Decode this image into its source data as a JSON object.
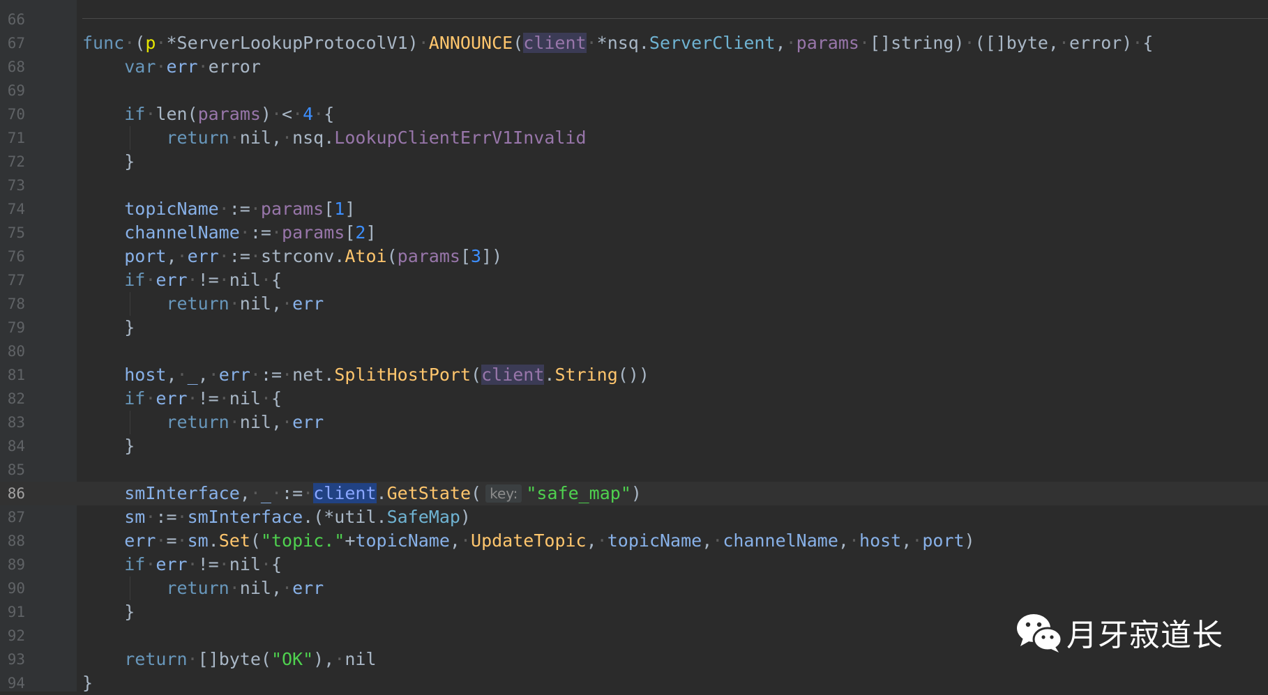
{
  "editor": {
    "current_line": "86",
    "lines": [
      {
        "n": "66"
      },
      {
        "n": "67",
        "tokens": [
          [
            "kw",
            "func"
          ],
          [
            "ws",
            "·"
          ],
          [
            "pt",
            "("
          ],
          [
            "rcv",
            "p"
          ],
          [
            "ws",
            "·"
          ],
          [
            "pt",
            "*ServerLookupProtocolV1"
          ],
          [
            "pt",
            ")"
          ],
          [
            "ws",
            "·"
          ],
          [
            "fn",
            "ANNOUNCE"
          ],
          [
            "pt",
            "("
          ],
          [
            "hl pr",
            "client"
          ],
          [
            "ws",
            "·"
          ],
          [
            "pt",
            "*nsq."
          ],
          [
            "tp",
            "ServerClient"
          ],
          [
            "pt",
            ","
          ],
          [
            "ws",
            "·"
          ],
          [
            "pr",
            "params"
          ],
          [
            "ws",
            "·"
          ],
          [
            "pt",
            "[]string)"
          ],
          [
            "ws",
            "·"
          ],
          [
            "pt",
            "([]byte,"
          ],
          [
            "ws",
            "·"
          ],
          [
            "pt",
            "error)"
          ],
          [
            "ws",
            "·"
          ],
          [
            "pt",
            "{"
          ]
        ]
      },
      {
        "n": "68",
        "tokens": [
          [
            "pt",
            "    "
          ],
          [
            "kw",
            "var"
          ],
          [
            "ws",
            "·"
          ],
          [
            "vr",
            "err"
          ],
          [
            "ws",
            "·"
          ],
          [
            "pt",
            "error"
          ]
        ]
      },
      {
        "n": "69"
      },
      {
        "n": "70",
        "tokens": [
          [
            "pt",
            "    "
          ],
          [
            "kw",
            "if"
          ],
          [
            "ws",
            "·"
          ],
          [
            "pt",
            "len("
          ],
          [
            "pr",
            "params"
          ],
          [
            "pt",
            ")"
          ],
          [
            "ws",
            "·"
          ],
          [
            "pt",
            "<"
          ],
          [
            "ws",
            "·"
          ],
          [
            "num",
            "4"
          ],
          [
            "ws",
            "·"
          ],
          [
            "pt",
            "{"
          ]
        ]
      },
      {
        "n": "71",
        "guide": true,
        "tokens": [
          [
            "pt",
            "        "
          ],
          [
            "kw",
            "return"
          ],
          [
            "ws",
            "·"
          ],
          [
            "pt",
            "nil,"
          ],
          [
            "ws",
            "·"
          ],
          [
            "pt",
            "nsq."
          ],
          [
            "pr",
            "LookupClientErrV1Invalid"
          ]
        ]
      },
      {
        "n": "72",
        "tokens": [
          [
            "pt",
            "    }"
          ]
        ]
      },
      {
        "n": "73"
      },
      {
        "n": "74",
        "tokens": [
          [
            "pt",
            "    "
          ],
          [
            "vr",
            "topicName"
          ],
          [
            "ws",
            "·"
          ],
          [
            "pt",
            ":="
          ],
          [
            "ws",
            "·"
          ],
          [
            "pr",
            "params"
          ],
          [
            "pt",
            "["
          ],
          [
            "num",
            "1"
          ],
          [
            "pt",
            "]"
          ]
        ]
      },
      {
        "n": "75",
        "tokens": [
          [
            "pt",
            "    "
          ],
          [
            "vr",
            "channelName"
          ],
          [
            "ws",
            "·"
          ],
          [
            "pt",
            ":="
          ],
          [
            "ws",
            "·"
          ],
          [
            "pr",
            "params"
          ],
          [
            "pt",
            "["
          ],
          [
            "num",
            "2"
          ],
          [
            "pt",
            "]"
          ]
        ]
      },
      {
        "n": "76",
        "tokens": [
          [
            "pt",
            "    "
          ],
          [
            "vr",
            "port"
          ],
          [
            "pt",
            ","
          ],
          [
            "ws",
            "·"
          ],
          [
            "vr",
            "err"
          ],
          [
            "ws",
            "·"
          ],
          [
            "pt",
            ":="
          ],
          [
            "ws",
            "·"
          ],
          [
            "pt",
            "strconv."
          ],
          [
            "fn",
            "Atoi"
          ],
          [
            "pt",
            "("
          ],
          [
            "pr",
            "params"
          ],
          [
            "pt",
            "["
          ],
          [
            "num",
            "3"
          ],
          [
            "pt",
            "])"
          ]
        ]
      },
      {
        "n": "77",
        "tokens": [
          [
            "pt",
            "    "
          ],
          [
            "kw",
            "if"
          ],
          [
            "ws",
            "·"
          ],
          [
            "vr",
            "err"
          ],
          [
            "ws",
            "·"
          ],
          [
            "pt",
            "!="
          ],
          [
            "ws",
            "·"
          ],
          [
            "pt",
            "nil"
          ],
          [
            "ws",
            "·"
          ],
          [
            "pt",
            "{"
          ]
        ]
      },
      {
        "n": "78",
        "guide": true,
        "tokens": [
          [
            "pt",
            "        "
          ],
          [
            "kw",
            "return"
          ],
          [
            "ws",
            "·"
          ],
          [
            "pt",
            "nil,"
          ],
          [
            "ws",
            "·"
          ],
          [
            "vr",
            "err"
          ]
        ]
      },
      {
        "n": "79",
        "tokens": [
          [
            "pt",
            "    }"
          ]
        ]
      },
      {
        "n": "80"
      },
      {
        "n": "81",
        "tokens": [
          [
            "pt",
            "    "
          ],
          [
            "vr",
            "host"
          ],
          [
            "pt",
            ","
          ],
          [
            "ws",
            "·"
          ],
          [
            "vr",
            "_"
          ],
          [
            "pt",
            ","
          ],
          [
            "ws",
            "·"
          ],
          [
            "vr",
            "err"
          ],
          [
            "ws",
            "·"
          ],
          [
            "pt",
            ":="
          ],
          [
            "ws",
            "·"
          ],
          [
            "pt",
            "net."
          ],
          [
            "fn",
            "SplitHostPort"
          ],
          [
            "pt",
            "("
          ],
          [
            "hl pr",
            "client"
          ],
          [
            "pt",
            "."
          ],
          [
            "fn",
            "String"
          ],
          [
            "pt",
            "())"
          ]
        ]
      },
      {
        "n": "82",
        "tokens": [
          [
            "pt",
            "    "
          ],
          [
            "kw",
            "if"
          ],
          [
            "ws",
            "·"
          ],
          [
            "vr",
            "err"
          ],
          [
            "ws",
            "·"
          ],
          [
            "pt",
            "!="
          ],
          [
            "ws",
            "·"
          ],
          [
            "pt",
            "nil"
          ],
          [
            "ws",
            "·"
          ],
          [
            "pt",
            "{"
          ]
        ]
      },
      {
        "n": "83",
        "guide": true,
        "tokens": [
          [
            "pt",
            "        "
          ],
          [
            "kw",
            "return"
          ],
          [
            "ws",
            "·"
          ],
          [
            "pt",
            "nil,"
          ],
          [
            "ws",
            "·"
          ],
          [
            "vr",
            "err"
          ]
        ]
      },
      {
        "n": "84",
        "tokens": [
          [
            "pt",
            "    }"
          ]
        ]
      },
      {
        "n": "85"
      },
      {
        "n": "86",
        "tokens": [
          [
            "pt",
            "    "
          ],
          [
            "vr",
            "smInterface"
          ],
          [
            "pt",
            ","
          ],
          [
            "ws",
            "·"
          ],
          [
            "vr",
            "_"
          ],
          [
            "ws",
            "·"
          ],
          [
            "pt",
            ":="
          ],
          [
            "ws",
            "·"
          ],
          [
            "hl2",
            "client"
          ],
          [
            "pt",
            "."
          ],
          [
            "fn",
            "GetState"
          ],
          [
            "pt",
            "("
          ],
          [
            "hint",
            "key:"
          ],
          [
            "str",
            "\"safe_map\""
          ],
          [
            "pt",
            ")"
          ]
        ]
      },
      {
        "n": "87",
        "tokens": [
          [
            "pt",
            "    "
          ],
          [
            "vr",
            "sm"
          ],
          [
            "ws",
            "·"
          ],
          [
            "pt",
            ":="
          ],
          [
            "ws",
            "·"
          ],
          [
            "vr",
            "smInterface"
          ],
          [
            "pt",
            ".(*util."
          ],
          [
            "tp",
            "SafeMap"
          ],
          [
            "pt",
            ")"
          ]
        ]
      },
      {
        "n": "88",
        "tokens": [
          [
            "pt",
            "    "
          ],
          [
            "vr",
            "err"
          ],
          [
            "ws",
            "·"
          ],
          [
            "pt",
            "="
          ],
          [
            "ws",
            "·"
          ],
          [
            "vr",
            "sm"
          ],
          [
            "pt",
            "."
          ],
          [
            "fn",
            "Set"
          ],
          [
            "pt",
            "("
          ],
          [
            "str",
            "\"topic.\""
          ],
          [
            "pt",
            "+"
          ],
          [
            "vr",
            "topicName"
          ],
          [
            "pt",
            ","
          ],
          [
            "ws",
            "·"
          ],
          [
            "fn",
            "UpdateTopic"
          ],
          [
            "pt",
            ","
          ],
          [
            "ws",
            "·"
          ],
          [
            "vr",
            "topicName"
          ],
          [
            "pt",
            ","
          ],
          [
            "ws",
            "·"
          ],
          [
            "vr",
            "channelName"
          ],
          [
            "pt",
            ","
          ],
          [
            "ws",
            "·"
          ],
          [
            "vr",
            "host"
          ],
          [
            "pt",
            ","
          ],
          [
            "ws",
            "·"
          ],
          [
            "vr",
            "port"
          ],
          [
            "pt",
            ")"
          ]
        ]
      },
      {
        "n": "89",
        "tokens": [
          [
            "pt",
            "    "
          ],
          [
            "kw",
            "if"
          ],
          [
            "ws",
            "·"
          ],
          [
            "vr",
            "err"
          ],
          [
            "ws",
            "·"
          ],
          [
            "pt",
            "!="
          ],
          [
            "ws",
            "·"
          ],
          [
            "pt",
            "nil"
          ],
          [
            "ws",
            "·"
          ],
          [
            "pt",
            "{"
          ]
        ]
      },
      {
        "n": "90",
        "guide": true,
        "tokens": [
          [
            "pt",
            "        "
          ],
          [
            "kw",
            "return"
          ],
          [
            "ws",
            "·"
          ],
          [
            "pt",
            "nil,"
          ],
          [
            "ws",
            "·"
          ],
          [
            "vr",
            "err"
          ]
        ]
      },
      {
        "n": "91",
        "tokens": [
          [
            "pt",
            "    }"
          ]
        ]
      },
      {
        "n": "92"
      },
      {
        "n": "93",
        "tokens": [
          [
            "pt",
            "    "
          ],
          [
            "kw",
            "return"
          ],
          [
            "ws",
            "·"
          ],
          [
            "pt",
            "[]byte("
          ],
          [
            "str",
            "\"OK\""
          ],
          [
            "pt",
            "),"
          ],
          [
            "ws",
            "·"
          ],
          [
            "pt",
            "nil"
          ]
        ]
      },
      {
        "n": "94",
        "tokens": [
          [
            "pt",
            "}"
          ]
        ]
      }
    ]
  },
  "watermark": {
    "icon": "wechat-icon",
    "text": "月牙寂道长"
  }
}
